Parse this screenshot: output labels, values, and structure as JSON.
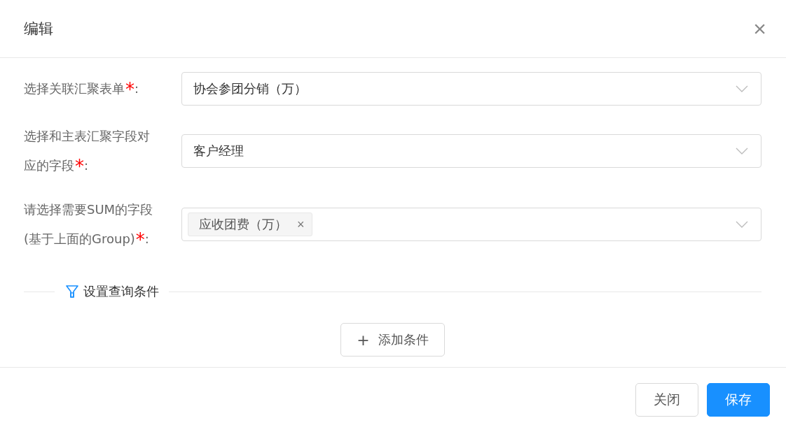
{
  "dialog": {
    "title": "编辑",
    "close_symbol": "×"
  },
  "fields": [
    {
      "kind": "select",
      "label_lines": [
        "选择关联汇聚表单"
      ],
      "required_mark": "*",
      "colon": ":",
      "value": "协会参团分销（万）"
    },
    {
      "kind": "select",
      "label_lines": [
        "选择和主表汇聚字段对",
        "应的字段"
      ],
      "required_mark": "*",
      "colon": ":",
      "value": "客户经理"
    },
    {
      "kind": "tags",
      "label_lines": [
        "请选择需要SUM的字段",
        "(基于上面的Group)"
      ],
      "required_mark": "*",
      "colon": ":",
      "tags": [
        {
          "label": "应收团费（万）",
          "remove": "×"
        }
      ]
    }
  ],
  "conditions": {
    "heading": "设置查询条件",
    "add_button": {
      "symbol": "+",
      "label": "添加条件"
    }
  },
  "footer": {
    "buttons": [
      {
        "label": "关闭",
        "primary": false
      },
      {
        "label": "保存",
        "primary": true
      }
    ]
  }
}
